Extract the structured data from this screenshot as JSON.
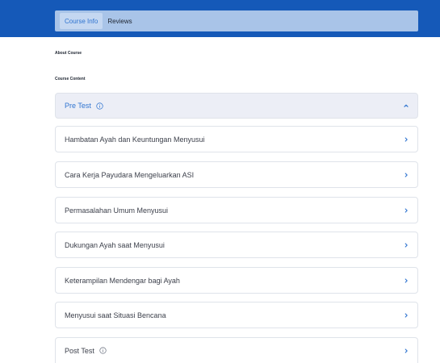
{
  "tabs": [
    {
      "label": "Course Info",
      "active": true
    },
    {
      "label": "Reviews",
      "active": false
    }
  ],
  "headings": {
    "about": "About Course",
    "content": "Course Content"
  },
  "items": [
    {
      "title": "Pre Test",
      "info": true,
      "expanded": true
    },
    {
      "title": "Hambatan Ayah dan Keuntungan Menyusui",
      "info": false,
      "expanded": false
    },
    {
      "title": "Cara Kerja Payudara Mengeluarkan ASI",
      "info": false,
      "expanded": false
    },
    {
      "title": "Permasalahan Umum Menyusui",
      "info": false,
      "expanded": false
    },
    {
      "title": "Dukungan Ayah saat Menyusui",
      "info": false,
      "expanded": false
    },
    {
      "title": "Keterampilan Mendengar bagi Ayah",
      "info": false,
      "expanded": false
    },
    {
      "title": "Menyusui saat Situasi Bencana",
      "info": false,
      "expanded": false
    },
    {
      "title": "Post Test",
      "info": true,
      "expanded": false
    }
  ],
  "colors": {
    "header": "#1559b8",
    "accent": "#2f74d0",
    "expanded_bg": "#eceef6"
  },
  "icons": {
    "info": "info-circle-icon",
    "expanded": "chevron-up-icon",
    "collapsed": "chevron-right-icon"
  }
}
